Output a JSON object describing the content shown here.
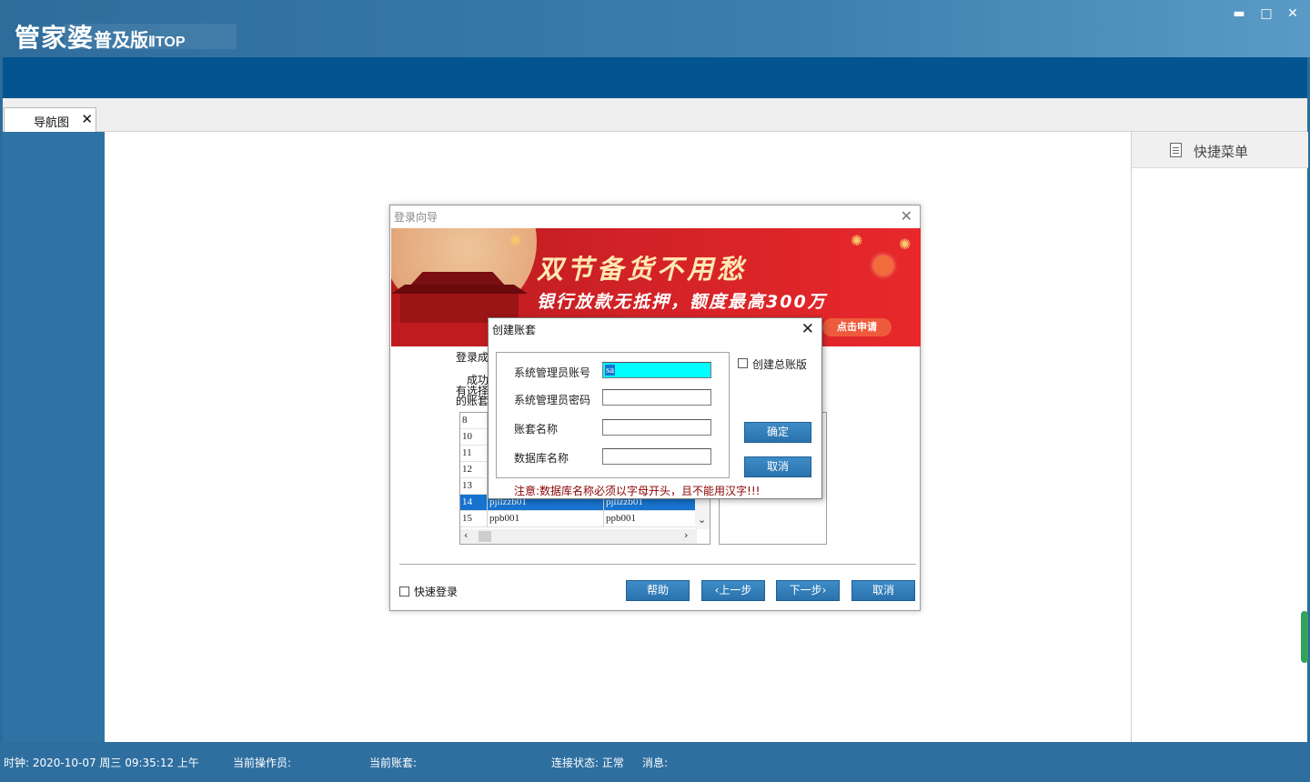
{
  "app": {
    "logo_main": "管家婆",
    "logo_edition": "普及版",
    "logo_suffix": "ⅡTOP",
    "window_controls": {
      "minimize": "▬",
      "maximize": "□",
      "close": "✕"
    }
  },
  "tabs": [
    {
      "label": "导航图",
      "close": "✕"
    }
  ],
  "quick_menu": {
    "label": "快捷菜单",
    "icon": "document-icon"
  },
  "statusbar": {
    "clock": "时钟: 2020-10-07 周三 09:35:12 上午",
    "operator": "当前操作员:",
    "account_set": "当前账套:",
    "connection": "连接状态: 正常",
    "message": "消息:"
  },
  "login_wizard": {
    "title": "登录向导",
    "close": "✕",
    "banner": {
      "headline": "双节备货不用愁",
      "subline": "银行放款无抵押，额度最高300万",
      "cta": "点击申请"
    },
    "partial_text": {
      "line1": "登录成",
      "line2": "成功",
      "line3": "有选择",
      "line4": "的账套"
    },
    "accounts": [
      {
        "num": "8",
        "name": "",
        "db": ""
      },
      {
        "num": "10",
        "name": "",
        "db": ""
      },
      {
        "num": "11",
        "name": "",
        "db": ""
      },
      {
        "num": "12",
        "name": "",
        "db": ""
      },
      {
        "num": "13",
        "name": "",
        "db": ""
      },
      {
        "num": "14",
        "name": "pjllzzb01",
        "db": "pjllzzb01",
        "selected": true
      },
      {
        "num": "15",
        "name": "ppb001",
        "db": "ppb001"
      }
    ],
    "quick_login_label": "快速登录",
    "buttons": {
      "help": "帮助",
      "prev": "‹上一步",
      "next": "下一步›",
      "cancel": "取消"
    }
  },
  "create_account": {
    "title": "创建账套",
    "close": "✕",
    "fields": {
      "admin_account_label": "系统管理员账号",
      "admin_account_value": "sa",
      "admin_password_label": "系统管理员密码",
      "admin_password_value": "",
      "set_name_label": "账套名称",
      "set_name_value": "",
      "db_name_label": "数据库名称",
      "db_name_value": ""
    },
    "ledger_checkbox_label": "创建总账版",
    "ok_label": "确定",
    "cancel_label": "取消",
    "note": "注意:数据库名称必须以字母开头，且不能用汉字!!!"
  },
  "colors": {
    "title_bar": "#3c7eae",
    "menu_bar": "#02558e",
    "status_bar": "#2e6fa0",
    "selection": "#1673cf",
    "active_field": "#00ffff",
    "note_text": "#8b0000"
  }
}
